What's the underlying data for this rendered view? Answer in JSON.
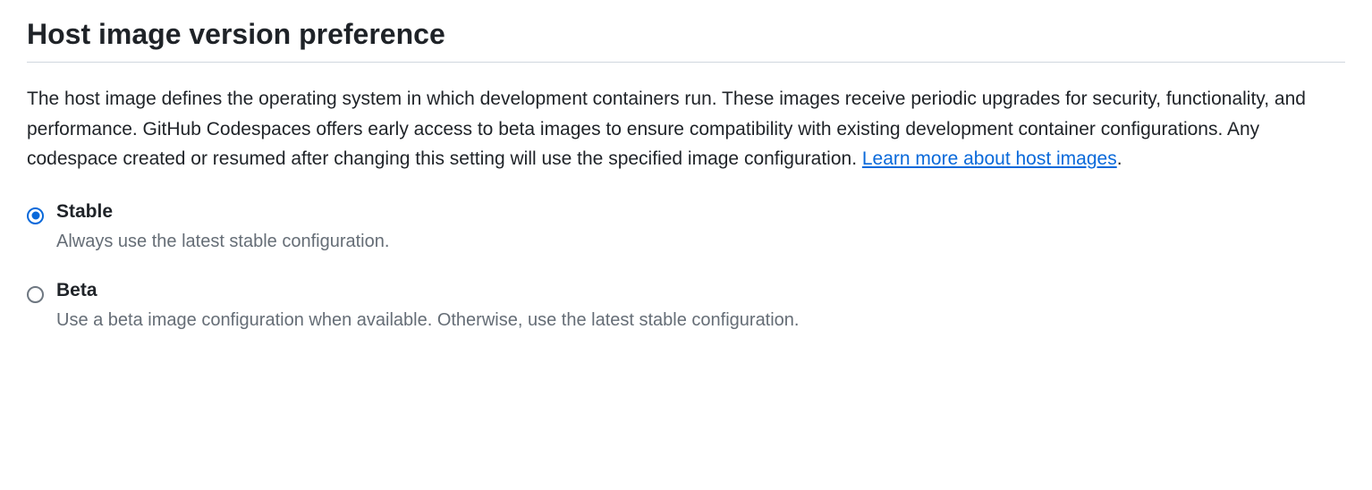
{
  "heading": "Host image version preference",
  "description_text": "The host image defines the operating system in which development containers run. These images receive periodic upgrades for security, functionality, and performance. GitHub Codespaces offers early access to beta images to ensure compatibility with existing development container configurations. Any codespace created or resumed after changing this setting will use the specified image configuration. ",
  "description_link": "Learn more about host images",
  "description_suffix": ".",
  "options": {
    "stable": {
      "label": "Stable",
      "description": "Always use the latest stable configuration.",
      "selected": true
    },
    "beta": {
      "label": "Beta",
      "description": "Use a beta image configuration when available. Otherwise, use the latest stable configuration.",
      "selected": false
    }
  }
}
